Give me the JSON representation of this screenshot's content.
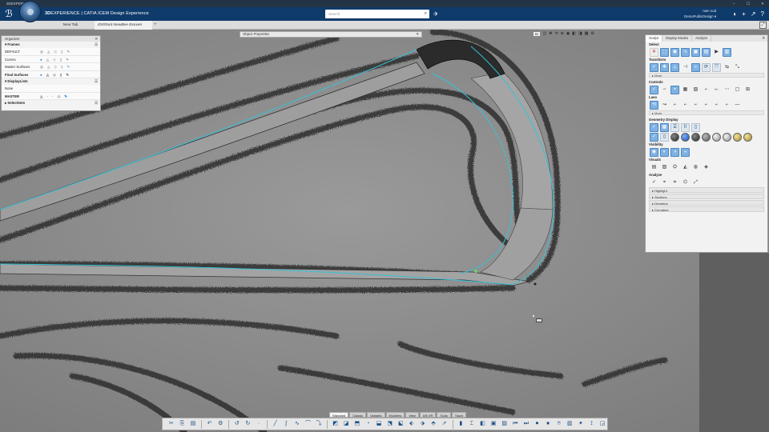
{
  "window": {
    "title": "3DEXPERIENCE",
    "controls": [
      "–",
      "☐",
      "✕"
    ]
  },
  "header": {
    "logo": "3DS",
    "brand_bold": "3D",
    "brand_rest": "EXPERIENCE | CATIA ICEM Design Experience",
    "search_placeholder": "Search",
    "user_line1": "nam nud",
    "user_line2": "DemoPublicDesign ▾"
  },
  "tabs": {
    "new_tab": "New Tab",
    "current_tab": "IDXRoot-NewBee Exoven",
    "add": "+"
  },
  "organizer": {
    "title": "Organizer",
    "frames_header": "▾ Frames",
    "rows": [
      {
        "label": "DEFAULT"
      },
      {
        "label": "Curves"
      },
      {
        "label": "Master Surfaces"
      },
      {
        "label": "Final Surfaces"
      }
    ],
    "displaylists_header": "▾ DisplayLists",
    "dl_rows": [
      {
        "label": "None"
      },
      {
        "label": "MASTER"
      }
    ],
    "selectsets_header": "▸ SelectSets"
  },
  "object_properties": {
    "title": "Object Properties"
  },
  "view_toolbar": {
    "zoom": "Bl"
  },
  "right_panel": {
    "tabs": [
      "Sculpt",
      "Display Modes",
      "Analyze"
    ],
    "sections": {
      "select": "Select",
      "transform": "Transform",
      "controls": "Controls",
      "lasso": "Laso",
      "geometry_display": "Geometry Display",
      "visibility": "Visibility",
      "visuals": "Visuals",
      "analyze": "Analyze"
    },
    "more_label": "▸ More",
    "analyze_items": [
      "Highlight",
      "Sections",
      "Deviation",
      "Curvature"
    ]
  },
  "bottom_tabs": [
    "Standard",
    "Classic",
    "Variants",
    "Enablers",
    "View",
    "AR-VR",
    "Tools",
    "Touch"
  ],
  "colors": {
    "header": "#0f3b6b",
    "accent": "#4b86c0",
    "curve": "#35c2d6"
  }
}
